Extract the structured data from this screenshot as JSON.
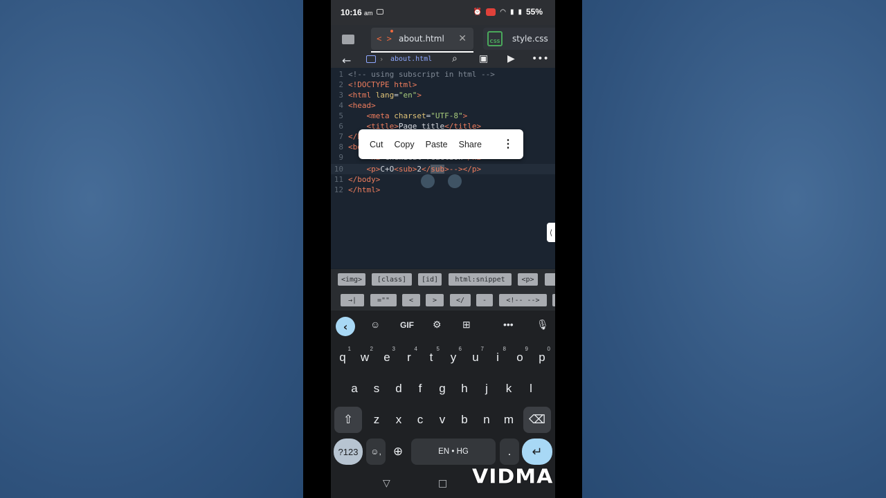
{
  "status": {
    "time": "10:16",
    "ampm": "am",
    "battery": "55%"
  },
  "tabs": [
    {
      "label": "about.html",
      "close": "✕"
    },
    {
      "label": "style.css",
      "icon_text": "CSS"
    }
  ],
  "toolbar": {
    "breadcrumb": "about.html"
  },
  "editor": {
    "lines": [
      {
        "num": "1"
      },
      {
        "num": "2"
      },
      {
        "num": "3"
      },
      {
        "num": "4"
      },
      {
        "num": "5"
      },
      {
        "num": "6"
      },
      {
        "num": "7"
      },
      {
        "num": "8"
      },
      {
        "num": "9"
      },
      {
        "num": "10"
      },
      {
        "num": "11"
      },
      {
        "num": "12"
      }
    ],
    "code": {
      "l1": "<!-- using subscript in html -->",
      "l2": "<!DOCTYPE html>",
      "l3a": "<html ",
      "l3b": "lang",
      "l3c": "=",
      "l3d": "\"en\"",
      "l3e": ">",
      "l4": "<head>",
      "l5a": "    <meta ",
      "l5b": "charset",
      "l5c": "=",
      "l5d": "\"UTF-8\"",
      "l5e": ">",
      "l6a": "    <title>",
      "l6b": "Page title",
      "l6c": "</title>",
      "l7": "</head>",
      "l8": "<body>",
      "l9a": "    <h2>",
      "l9b": "Chemical reaction",
      "l9c": "</h2>",
      "l10a": "    <p>",
      "l10b": "C+O",
      "l10c": "<sub>",
      "l10d": "2",
      "l10e": "</",
      "l10f": "sub",
      "l10g": ">-->",
      "l10h": "</p>",
      "l11": "</body>",
      "l12": "</html>"
    }
  },
  "context_menu": {
    "items": [
      "Cut",
      "Copy",
      "Paste",
      "Share"
    ]
  },
  "snippets_row1": [
    "<img>",
    "[class]",
    "[id]",
    "html:snippet",
    "<p>"
  ],
  "snippets_row2": [
    "→|",
    "=\"\"",
    "<",
    ">",
    "</",
    "-",
    "<!-- -->"
  ],
  "keyboard": {
    "top": {
      "gif": "GIF"
    },
    "row1": [
      {
        "k": "q",
        "n": "1"
      },
      {
        "k": "w",
        "n": "2"
      },
      {
        "k": "e",
        "n": "3"
      },
      {
        "k": "r",
        "n": "4"
      },
      {
        "k": "t",
        "n": "5"
      },
      {
        "k": "y",
        "n": "6"
      },
      {
        "k": "u",
        "n": "7"
      },
      {
        "k": "i",
        "n": "8"
      },
      {
        "k": "o",
        "n": "9"
      },
      {
        "k": "p",
        "n": "0"
      }
    ],
    "row2": [
      "a",
      "s",
      "d",
      "f",
      "g",
      "h",
      "j",
      "k",
      "l"
    ],
    "row3": [
      "z",
      "x",
      "c",
      "v",
      "b",
      "n",
      "m"
    ],
    "sym": "?123",
    "space": "EN • HG",
    "period": "."
  },
  "watermark": "VIDMA"
}
